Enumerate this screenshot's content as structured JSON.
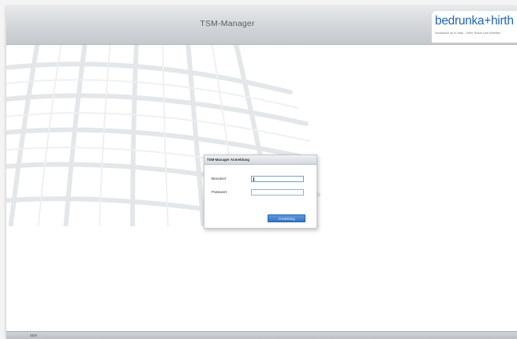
{
  "header": {
    "title": "TSM-Manager",
    "logo_text": "bedrunka+hirth",
    "logo_tagline": "Workplace up to date – mehr Raum zum Arbeiten",
    "logo_color": "#1f66b3"
  },
  "login_dialog": {
    "title": "TSM-Manager Anmeldung",
    "username_label": "Benutzer:",
    "username_value": "",
    "password_label": "Passwort:",
    "password_value": "",
    "submit_label": "Anmeldung",
    "button_color": "#3f80d0"
  },
  "footer": {
    "text": "SSH"
  }
}
